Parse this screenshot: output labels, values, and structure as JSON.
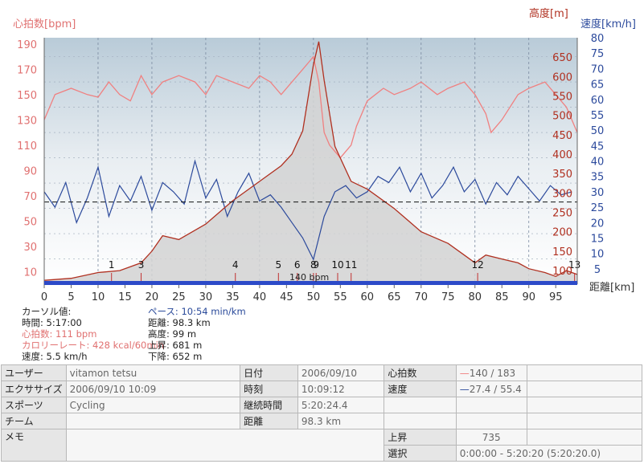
{
  "chart_data": {
    "type": "line",
    "y_left_label": "心拍数[bpm]",
    "y_right_labels": {
      "altitude": "高度[m]",
      "speed": "速度[km/h]"
    },
    "x_label": "距離[km]",
    "x_ticks": [
      "0",
      "5",
      "10",
      "15",
      "20",
      "25",
      "30",
      "35",
      "40",
      "45",
      "50",
      "55",
      "60",
      "65",
      "70",
      "75",
      "80",
      "85",
      "90",
      "95"
    ],
    "x_range": [
      0,
      99
    ],
    "hr_ticks": [
      "10",
      "30",
      "50",
      "70",
      "90",
      "110",
      "130",
      "150",
      "170",
      "190"
    ],
    "hr_range": [
      0,
      195
    ],
    "speed_ticks": [
      "5",
      "10",
      "15",
      "20",
      "25",
      "30",
      "35",
      "40",
      "45",
      "50",
      "55",
      "60",
      "65",
      "70",
      "75",
      "80"
    ],
    "speed_range": [
      0,
      80
    ],
    "alt_ticks": [
      "100",
      "150",
      "200",
      "250",
      "300",
      "350",
      "400",
      "450",
      "500",
      "550",
      "600",
      "650"
    ],
    "alt_range": [
      65,
      700
    ],
    "hr_reference": {
      "value": 140,
      "label": "140 bpm"
    },
    "lap_markers": [
      {
        "label": "1",
        "x": 12.5
      },
      {
        "label": "3",
        "x": 18
      },
      {
        "label": "4",
        "x": 35.5
      },
      {
        "label": "5",
        "x": 43.5
      },
      {
        "label": "6",
        "x": 47
      },
      {
        "label": "8",
        "x": 50
      },
      {
        "label": "9",
        "x": 50.5
      },
      {
        "label": "10",
        "x": 54.5
      },
      {
        "label": "11",
        "x": 57
      },
      {
        "label": "12",
        "x": 80.5
      },
      {
        "label": "13",
        "x": 98.5
      }
    ],
    "series": [
      {
        "name": "心拍数",
        "color": "#f08080",
        "x": [
          0,
          2,
          5,
          8,
          10,
          12,
          14,
          16,
          18,
          20,
          22,
          25,
          28,
          30,
          32,
          35,
          38,
          40,
          42,
          44,
          46,
          48,
          49,
          50,
          51,
          52,
          53,
          55,
          56,
          57,
          58,
          60,
          63,
          65,
          68,
          70,
          73,
          75,
          78,
          80,
          82,
          83,
          85,
          88,
          90,
          93,
          95,
          97,
          99
        ],
        "values": [
          130,
          150,
          155,
          150,
          148,
          160,
          150,
          145,
          165,
          150,
          160,
          165,
          160,
          150,
          165,
          160,
          155,
          165,
          160,
          150,
          160,
          170,
          175,
          180,
          160,
          120,
          110,
          100,
          105,
          110,
          125,
          145,
          155,
          150,
          155,
          160,
          150,
          155,
          160,
          150,
          135,
          120,
          130,
          150,
          155,
          160,
          150,
          140,
          120
        ]
      },
      {
        "name": "高度",
        "color": "#b03020",
        "x": [
          0,
          5,
          10,
          14,
          18,
          20,
          22,
          25,
          30,
          35,
          40,
          44,
          46,
          48,
          50,
          51,
          52,
          54,
          57,
          60,
          65,
          70,
          75,
          78,
          80,
          82,
          85,
          88,
          90,
          93,
          95,
          97,
          99
        ],
        "values": [
          75,
          80,
          95,
          100,
          120,
          150,
          190,
          180,
          220,
          280,
          330,
          370,
          400,
          460,
          630,
          690,
          590,
          420,
          330,
          310,
          260,
          200,
          170,
          140,
          120,
          140,
          130,
          120,
          105,
          95,
          85,
          100,
          90
        ]
      },
      {
        "name": "速度",
        "color": "#2c4a9c",
        "x": [
          0,
          2,
          4,
          6,
          8,
          10,
          12,
          14,
          16,
          18,
          20,
          22,
          24,
          26,
          28,
          30,
          32,
          34,
          36,
          38,
          40,
          42,
          44,
          46,
          48,
          50,
          52,
          54,
          56,
          58,
          60,
          62,
          64,
          66,
          68,
          70,
          72,
          74,
          76,
          78,
          80,
          82,
          84,
          86,
          88,
          90,
          92,
          94,
          96,
          98
        ],
        "values": [
          30,
          25,
          33,
          20,
          28,
          38,
          22,
          32,
          27,
          35,
          24,
          33,
          30,
          26,
          40,
          28,
          34,
          22,
          30,
          36,
          27,
          29,
          25,
          20,
          15,
          8,
          22,
          30,
          32,
          28,
          30,
          35,
          33,
          38,
          30,
          36,
          28,
          32,
          38,
          30,
          34,
          26,
          33,
          29,
          35,
          31,
          27,
          32,
          29,
          30
        ]
      }
    ],
    "series_legend": {
      "hr": "心拍数",
      "hr_value": "140 / 183",
      "speed": "速度",
      "speed_value": "27.4 / 55.4"
    }
  },
  "cursor": {
    "title": "カーソル値:",
    "time": "時間: 5:17:00",
    "hr": "心拍数: 111 bpm",
    "calorie": "カロリーレート: 428 kcal/60min",
    "speed": "速度: 5.5 km/h",
    "pace": "ペース: 10:54 min/km",
    "distance": "距離: 98.3 km",
    "altitude": "高度: 99 m",
    "ascent": "上昇: 681 m",
    "descent": "下降: 652 m"
  },
  "summary": {
    "user_label": "ユーザー",
    "user_value": "vitamon tetsu",
    "exercise_label": "エクササイズ",
    "exercise_value": "2006/09/10 10:09",
    "sport_label": "スポーツ",
    "sport_value": "Cycling",
    "team_label": "チーム",
    "team_value": "",
    "memo_label": "メモ",
    "memo_value": "",
    "date_label": "日付",
    "date_value": "2006/09/10",
    "time_label": "時刻",
    "time_value": "10:09:12",
    "duration_label": "継続時間",
    "duration_value": "5:20:24.4",
    "distance_label": "距離",
    "distance_value": "98.3 km",
    "hr_label": "心拍数",
    "hr_value": "140 / 183",
    "speed_label": "速度",
    "speed_value": "27.4 / 55.4",
    "ascent_label": "上昇",
    "ascent_value": "735",
    "selection_label": "選択",
    "selection_value": "0:00:00 - 5:20:20 (5:20:20.0)"
  },
  "colors": {
    "hr": "#f08080",
    "altitude": "#b03020",
    "speed": "#2c4a9c",
    "plot_bg_top": "#b9cbd8",
    "plot_bg_bottom": "#ffffff"
  }
}
